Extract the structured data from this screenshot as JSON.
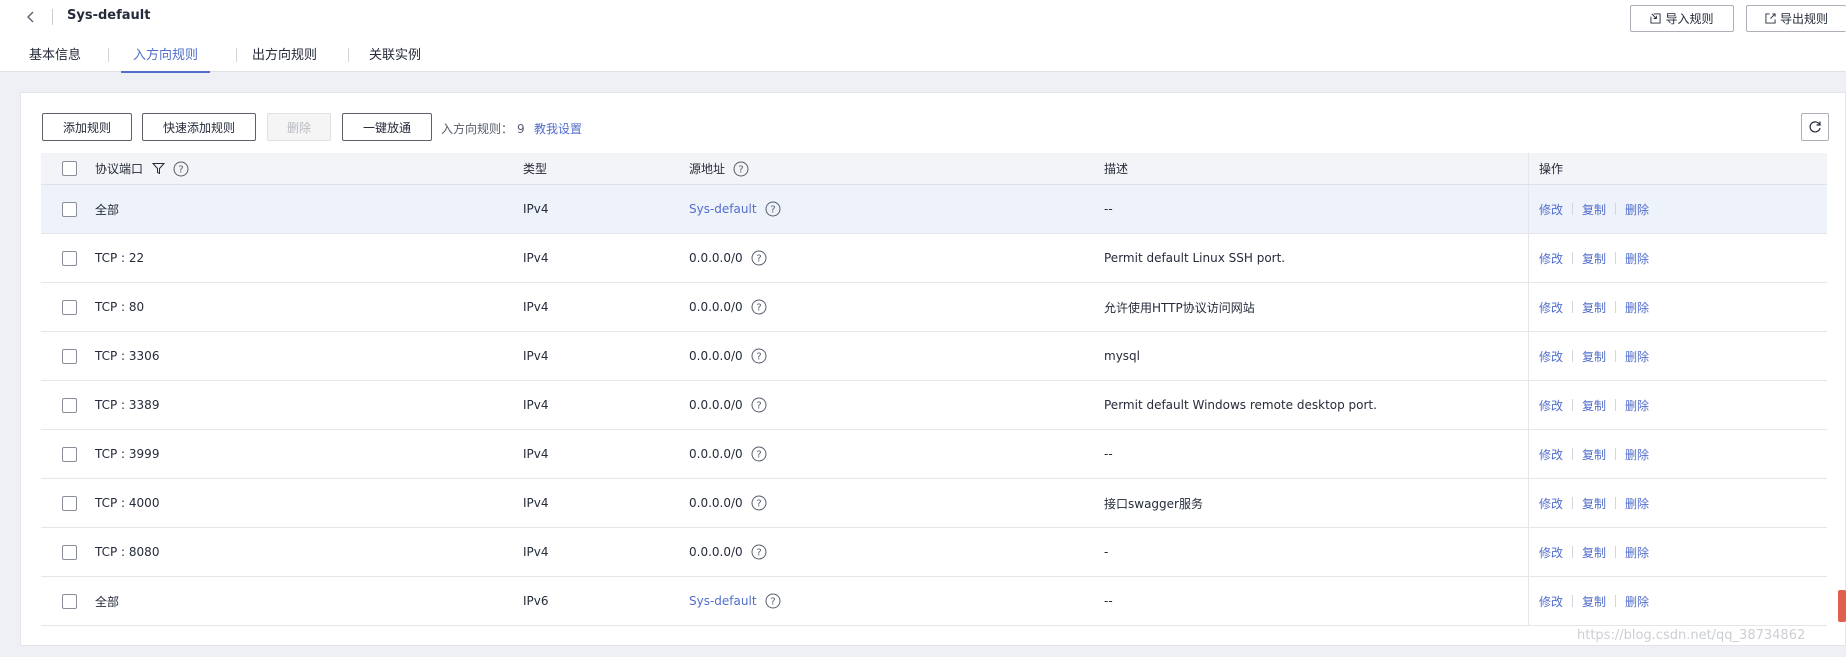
{
  "header": {
    "title": "Sys-default",
    "import_label": "导入规则",
    "export_label": "导出规则"
  },
  "tabs": [
    {
      "label": "基本信息",
      "active": false
    },
    {
      "label": "入方向规则",
      "active": true
    },
    {
      "label": "出方向规则",
      "active": false
    },
    {
      "label": "关联实例",
      "active": false
    }
  ],
  "toolbar": {
    "add_label": "添加规则",
    "quick_add_label": "快速添加规则",
    "delete_label": "删除",
    "one_click_label": "一键放通",
    "rule_count_label": "入方向规则：",
    "rule_count": "9",
    "help_label": "教我设置"
  },
  "table": {
    "headers": {
      "port": "协议端口",
      "type": "类型",
      "source": "源地址",
      "description": "描述",
      "actions": "操作"
    },
    "rows": [
      {
        "port": "全部",
        "type": "IPv4",
        "source": "Sys-default",
        "source_is_link": true,
        "description": "--"
      },
      {
        "port": "TCP : 22",
        "type": "IPv4",
        "source": "0.0.0.0/0",
        "source_is_link": false,
        "description": "Permit default Linux SSH port."
      },
      {
        "port": "TCP : 80",
        "type": "IPv4",
        "source": "0.0.0.0/0",
        "source_is_link": false,
        "description": "允许使用HTTP协议访问网站"
      },
      {
        "port": "TCP : 3306",
        "type": "IPv4",
        "source": "0.0.0.0/0",
        "source_is_link": false,
        "description": "mysql"
      },
      {
        "port": "TCP : 3389",
        "type": "IPv4",
        "source": "0.0.0.0/0",
        "source_is_link": false,
        "description": "Permit default Windows remote desktop port."
      },
      {
        "port": "TCP : 3999",
        "type": "IPv4",
        "source": "0.0.0.0/0",
        "source_is_link": false,
        "description": "--"
      },
      {
        "port": "TCP : 4000",
        "type": "IPv4",
        "source": "0.0.0.0/0",
        "source_is_link": false,
        "description": "接口swagger服务"
      },
      {
        "port": "TCP : 8080",
        "type": "IPv4",
        "source": "0.0.0.0/0",
        "source_is_link": false,
        "description": "-"
      },
      {
        "port": "全部",
        "type": "IPv6",
        "source": "Sys-default",
        "source_is_link": true,
        "description": "--"
      }
    ],
    "row_actions": {
      "modify": "修改",
      "copy": "复制",
      "delete": "删除"
    }
  },
  "watermark": "https://blog.csdn.net/qq_38734862",
  "colors": {
    "accent": "#526ecc",
    "scroll_thumb": "#e0604f"
  }
}
